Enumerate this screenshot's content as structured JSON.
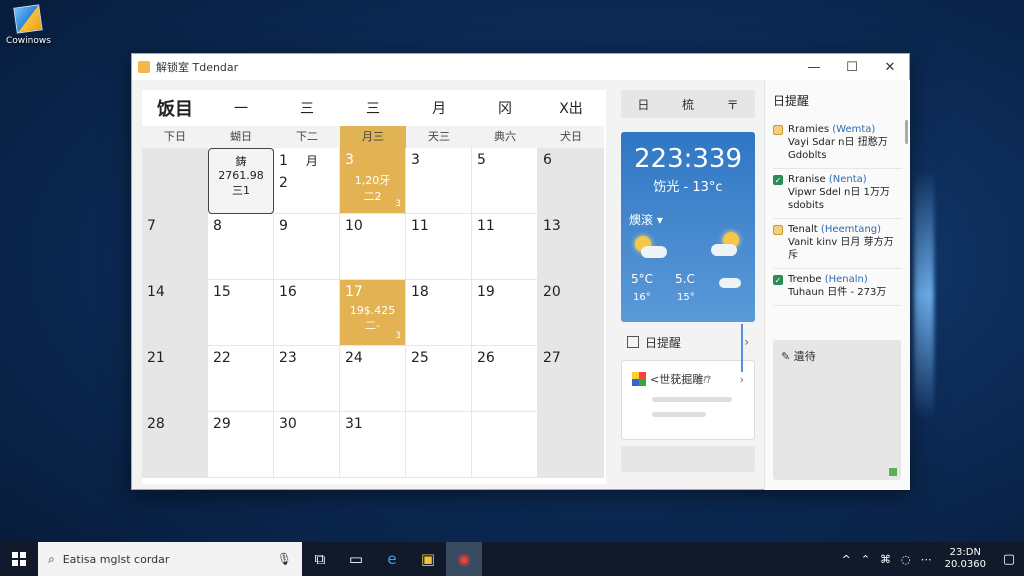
{
  "desktop": {
    "icon_label": "Cowinows"
  },
  "window": {
    "title": "解锁室 Tdendar",
    "minimize": "—",
    "maximize": "☐",
    "close": "✕"
  },
  "calendar": {
    "header": [
      "饭目",
      "一",
      "三",
      "三",
      "月",
      "冈",
      "X出"
    ],
    "weekdays": [
      "下日",
      "蝴日",
      "下二",
      "月三",
      "天三",
      "典六",
      "犬日"
    ],
    "highlight_weekday_index": 3,
    "rows": [
      [
        {
          "day": "",
          "weekend": true
        },
        {
          "day": "",
          "today": true,
          "box_lines": [
            "鋳",
            "2761.98",
            "三1"
          ]
        },
        {
          "day": "1",
          "extra": "月",
          "under": "2"
        },
        {
          "day": "3",
          "event": true,
          "sub": "1,20牙\n二2",
          "small": "3"
        },
        {
          "day": "3"
        },
        {
          "day": "5"
        },
        {
          "day": "6",
          "weekend": true
        }
      ],
      [
        {
          "day": "7",
          "weekend": true
        },
        {
          "day": "8"
        },
        {
          "day": "9"
        },
        {
          "day": "10"
        },
        {
          "day": "11"
        },
        {
          "day": "11"
        },
        {
          "day": "13",
          "weekend": true
        }
      ],
      [
        {
          "day": "14",
          "weekend": true
        },
        {
          "day": "15"
        },
        {
          "day": "16"
        },
        {
          "day": "17",
          "event": true,
          "sub": "19$.425\n二-",
          "small": "3"
        },
        {
          "day": "18"
        },
        {
          "day": "19"
        },
        {
          "day": "20",
          "weekend": true
        }
      ],
      [
        {
          "day": "21",
          "weekend": true
        },
        {
          "day": "22"
        },
        {
          "day": "23"
        },
        {
          "day": "24"
        },
        {
          "day": "25"
        },
        {
          "day": "26"
        },
        {
          "day": "27",
          "weekend": true
        }
      ],
      [
        {
          "day": "28",
          "weekend": true
        },
        {
          "day": "29"
        },
        {
          "day": "30"
        },
        {
          "day": "31"
        },
        {
          "day": ""
        },
        {
          "day": ""
        },
        {
          "day": "",
          "weekend": true
        }
      ]
    ]
  },
  "middle": {
    "tabs": [
      "日",
      "梳",
      "〒"
    ],
    "weather": {
      "time": "223:339",
      "condition": "饬光 - 13°c",
      "location": "燠滚 ▾",
      "forecast": [
        {
          "temp": "5°C",
          "low": "16°"
        },
        {
          "temp": "5.C",
          "low": "15°"
        }
      ]
    },
    "reminder_label": "日提醒",
    "add_label": "<世莸掘雕",
    "add_hint": "疗"
  },
  "right": {
    "header": "日提醒",
    "tasks": [
      {
        "status": "pending",
        "title": "Rramies",
        "tag": "(Wemta)",
        "desc": "Vayi Sdar n日 扭憨万 Gdoblts"
      },
      {
        "status": "done",
        "title": "Rranise",
        "tag": "(Nenta)",
        "desc": "Vipwr Sdel n日 1万万 sdobits"
      },
      {
        "status": "pending",
        "title": "Tenalt",
        "tag": "(Heemtang)",
        "desc": "Vanit kinv 日月 芽方万 斥"
      },
      {
        "status": "done",
        "title": "Trenbe",
        "tag": "(Henaln)",
        "desc": "Tuhaun 日件 - 273万"
      }
    ],
    "notes_label": "遺待"
  },
  "taskbar": {
    "search_placeholder": "Eatisa mglst cordar",
    "clock_time": "23:DN",
    "clock_date": "20.0360",
    "tray_icons": [
      "^",
      "⌃",
      "⌘",
      "◌",
      "⋯"
    ]
  }
}
